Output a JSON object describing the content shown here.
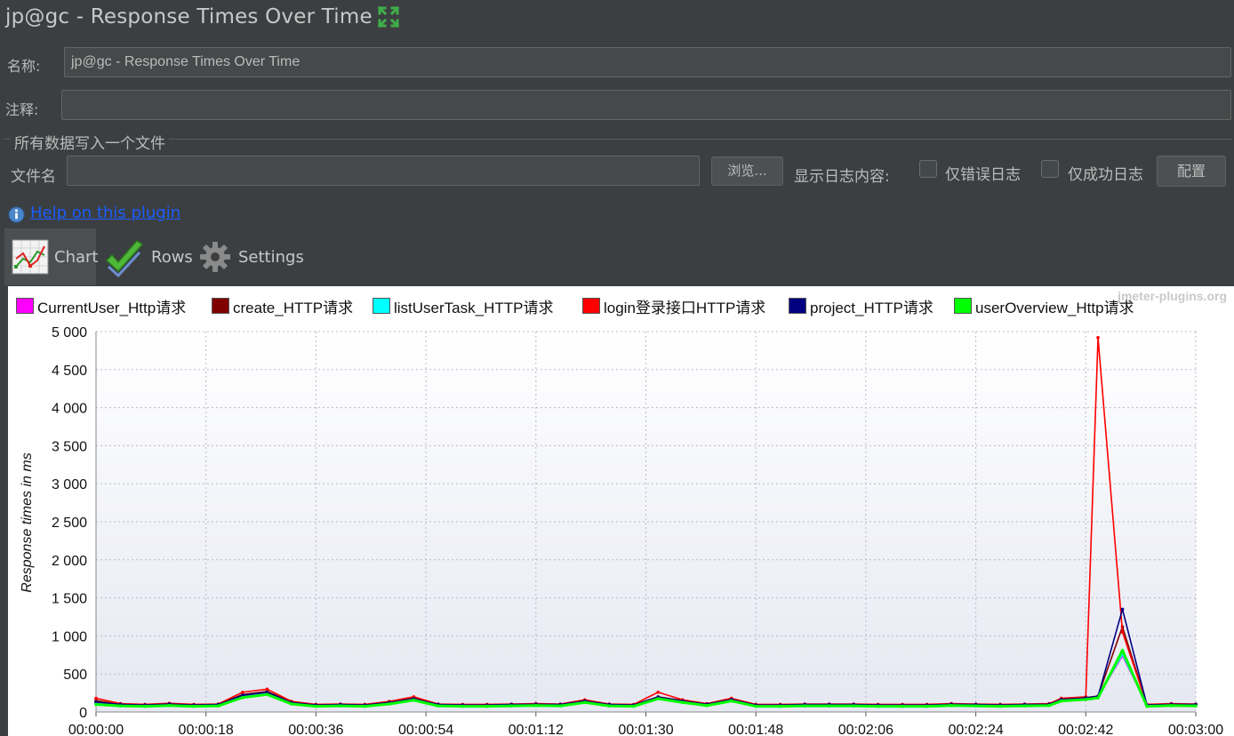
{
  "window": {
    "title": "jp@gc - Response Times Over Time"
  },
  "form": {
    "name_label": "名称:",
    "name_value": "jp@gc - Response Times Over Time",
    "comment_label": "注释:",
    "comment_value": "",
    "file_section_title": "所有数据写入一个文件",
    "filename_label": "文件名",
    "filename_value": "",
    "browse_label": "浏览...",
    "log_content_label": "显示日志内容:",
    "errors_only_label": "仅错误日志",
    "errors_only_checked": false,
    "success_only_label": "仅成功日志",
    "success_only_checked": false,
    "configure_label": "配置"
  },
  "help": {
    "link_text": "Help on this plugin",
    "icon": "info-icon"
  },
  "tabs": [
    {
      "label": "Chart",
      "icon": "chart-icon",
      "active": true
    },
    {
      "label": "Rows",
      "icon": "checkmark-icon",
      "active": false
    },
    {
      "label": "Settings",
      "icon": "gear-icon",
      "active": false
    }
  ],
  "watermark": "jmeter-plugins.org",
  "chart_data": {
    "type": "line",
    "title": "",
    "xlabel": "",
    "ylabel": "Response times in ms",
    "ylim": [
      0,
      5000
    ],
    "y_ticks": [
      "0",
      "500",
      "1 000",
      "1 500",
      "2 000",
      "2 500",
      "3 000",
      "3 500",
      "4 000",
      "4 500",
      "5 000"
    ],
    "x_ticks": [
      "00:00:00",
      "00:00:18",
      "00:00:36",
      "00:00:54",
      "00:01:12",
      "00:01:30",
      "00:01:48",
      "00:02:06",
      "00:02:24",
      "00:02:42",
      "00:03:00"
    ],
    "grid": true,
    "legend_position": "top",
    "series": [
      {
        "name": "CurrentUser_Http请求",
        "color": "#ff00ff",
        "x": [
          0,
          4,
          8,
          12,
          16,
          20,
          24,
          28,
          32,
          36,
          40,
          44,
          48,
          52,
          56,
          60,
          64,
          68,
          72,
          76,
          80,
          84,
          88,
          92,
          96,
          100,
          104,
          108,
          112,
          116,
          120,
          124,
          128,
          132,
          136,
          140,
          144,
          148,
          152,
          156,
          158,
          162,
          164,
          168,
          172,
          176,
          180
        ],
        "y": [
          120,
          95,
          90,
          100,
          90,
          95,
          210,
          250,
          120,
          90,
          95,
          90,
          120,
          170,
          95,
          90,
          90,
          95,
          100,
          95,
          140,
          95,
          90,
          190,
          140,
          100,
          160,
          90,
          90,
          95,
          95,
          95,
          90,
          90,
          90,
          100,
          95,
          90,
          95,
          100,
          160,
          180,
          200,
          740,
          90,
          100,
          95
        ]
      },
      {
        "name": "create_HTTP请求",
        "color": "#800000",
        "x": [
          0,
          4,
          8,
          12,
          16,
          20,
          24,
          28,
          32,
          36,
          40,
          44,
          48,
          52,
          56,
          60,
          64,
          68,
          72,
          76,
          80,
          84,
          88,
          92,
          96,
          100,
          104,
          108,
          112,
          116,
          120,
          124,
          128,
          132,
          136,
          140,
          144,
          148,
          152,
          156,
          158,
          162,
          164,
          168,
          172,
          176,
          180
        ],
        "y": [
          150,
          100,
          95,
          110,
          95,
          100,
          230,
          270,
          130,
          95,
          100,
          95,
          130,
          180,
          100,
          95,
          95,
          100,
          105,
          100,
          150,
          100,
          95,
          200,
          150,
          105,
          170,
          95,
          95,
          100,
          100,
          100,
          95,
          95,
          95,
          105,
          100,
          95,
          100,
          105,
          170,
          190,
          210,
          1120,
          95,
          105,
          100
        ]
      },
      {
        "name": "listUserTask_HTTP请求",
        "color": "#00ffff",
        "x": [
          0,
          4,
          8,
          12,
          16,
          20,
          24,
          28,
          32,
          36,
          40,
          44,
          48,
          52,
          56,
          60,
          64,
          68,
          72,
          76,
          80,
          84,
          88,
          92,
          96,
          100,
          104,
          108,
          112,
          116,
          120,
          124,
          128,
          132,
          136,
          140,
          144,
          148,
          152,
          156,
          158,
          162,
          164,
          168,
          172,
          176,
          180
        ],
        "y": [
          110,
          90,
          85,
          95,
          85,
          90,
          200,
          240,
          115,
          85,
          90,
          85,
          115,
          165,
          90,
          85,
          85,
          90,
          95,
          90,
          135,
          90,
          85,
          185,
          135,
          95,
          155,
          85,
          85,
          90,
          90,
          90,
          85,
          85,
          85,
          95,
          90,
          85,
          90,
          95,
          155,
          175,
          195,
          760,
          85,
          95,
          90
        ]
      },
      {
        "name": "login登录接口HTTP请求",
        "color": "#ff0000",
        "x": [
          0,
          4,
          8,
          12,
          16,
          20,
          24,
          28,
          32,
          36,
          40,
          44,
          48,
          52,
          56,
          60,
          64,
          68,
          72,
          76,
          80,
          84,
          88,
          92,
          96,
          100,
          104,
          108,
          112,
          116,
          120,
          124,
          128,
          132,
          136,
          140,
          144,
          148,
          152,
          156,
          158,
          162,
          164,
          168,
          172,
          176,
          180
        ],
        "y": [
          180,
          110,
          100,
          115,
          100,
          105,
          260,
          300,
          140,
          100,
          105,
          100,
          140,
          200,
          105,
          100,
          100,
          105,
          110,
          105,
          160,
          105,
          100,
          260,
          160,
          110,
          180,
          100,
          100,
          105,
          105,
          105,
          100,
          100,
          100,
          110,
          105,
          100,
          105,
          110,
          180,
          200,
          4920,
          1050,
          100,
          110,
          105
        ]
      },
      {
        "name": "project_HTTP请求",
        "color": "#000080",
        "x": [
          0,
          4,
          8,
          12,
          16,
          20,
          24,
          28,
          32,
          36,
          40,
          44,
          48,
          52,
          56,
          60,
          64,
          68,
          72,
          76,
          80,
          84,
          88,
          92,
          96,
          100,
          104,
          108,
          112,
          116,
          120,
          124,
          128,
          132,
          136,
          140,
          144,
          148,
          152,
          156,
          158,
          162,
          164,
          168,
          172,
          176,
          180
        ],
        "y": [
          130,
          100,
          92,
          105,
          92,
          98,
          220,
          260,
          125,
          92,
          98,
          92,
          125,
          175,
          98,
          92,
          92,
          98,
          102,
          98,
          145,
          98,
          92,
          195,
          145,
          102,
          165,
          92,
          92,
          98,
          98,
          98,
          92,
          92,
          92,
          102,
          98,
          92,
          98,
          102,
          165,
          185,
          205,
          1350,
          92,
          102,
          98
        ]
      },
      {
        "name": "userOverview_Http请求",
        "color": "#00ff00",
        "x": [
          0,
          4,
          8,
          12,
          16,
          20,
          24,
          28,
          32,
          36,
          40,
          44,
          48,
          52,
          56,
          60,
          64,
          68,
          72,
          76,
          80,
          84,
          88,
          92,
          96,
          100,
          104,
          108,
          112,
          116,
          120,
          124,
          128,
          132,
          136,
          140,
          144,
          148,
          152,
          156,
          158,
          162,
          164,
          168,
          172,
          176,
          180
        ],
        "y": [
          100,
          80,
          75,
          85,
          75,
          80,
          190,
          230,
          105,
          75,
          80,
          75,
          105,
          155,
          80,
          75,
          75,
          80,
          85,
          80,
          125,
          80,
          75,
          175,
          125,
          85,
          145,
          75,
          75,
          80,
          80,
          80,
          75,
          75,
          75,
          85,
          80,
          75,
          80,
          85,
          145,
          165,
          185,
          810,
          75,
          85,
          80
        ]
      }
    ]
  }
}
